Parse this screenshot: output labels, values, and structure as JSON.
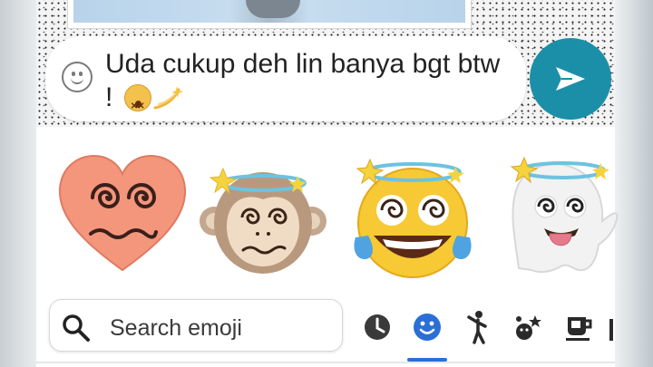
{
  "composer": {
    "message_text": "Uda cukup deh lin banya bgt btw !",
    "trailing_emojis": [
      "dizzy-face-emoji",
      "dizzy-symbol-emoji"
    ]
  },
  "stickers": [
    {
      "name": "dizzy-heart-sticker"
    },
    {
      "name": "dizzy-monkey-sticker"
    },
    {
      "name": "dizzy-laughing-crying-sticker"
    },
    {
      "name": "dizzy-ghost-sticker"
    }
  ],
  "search": {
    "placeholder": "Search emoji"
  },
  "categories": [
    {
      "icon": "clock-icon",
      "active": false
    },
    {
      "icon": "smiley-icon",
      "active": true
    },
    {
      "icon": "person-icon",
      "active": false
    },
    {
      "icon": "animal-nature-icon",
      "active": false
    },
    {
      "icon": "coffee-icon",
      "active": false
    }
  ],
  "colors": {
    "send_button": "#1b8fa8",
    "active_category": "#2b6fd6",
    "text": "#222222"
  }
}
